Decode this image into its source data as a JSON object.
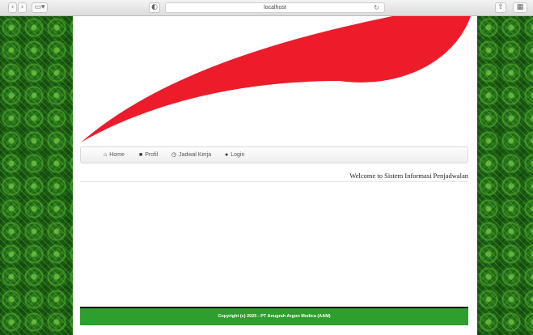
{
  "browser": {
    "url": "localhost",
    "back_icon": "chevron-left-icon",
    "forward_icon": "chevron-right-icon",
    "sidebar_icon": "sidebar-icon",
    "privacy_icon": "shield-icon",
    "reload_icon": "reload-icon",
    "share_icon": "share-icon",
    "tabs_icon": "tabs-icon"
  },
  "nav": {
    "items": [
      {
        "label": "Home",
        "icon": "home-icon"
      },
      {
        "label": "Profil",
        "icon": "book-icon"
      },
      {
        "label": "Jadwal Kerja",
        "icon": "clock-icon"
      },
      {
        "label": "Login",
        "icon": "user-icon"
      }
    ]
  },
  "welcome": "Welcome to Sistem Informasi Penjadwalan",
  "footer": "Copyright (c) 2025 - PT Anugrah Argon Medica (AAM)",
  "colors": {
    "brand_red": "#ec1c2b",
    "footer_green": "#2e9e2e",
    "pattern_green": "#1d5f14"
  }
}
